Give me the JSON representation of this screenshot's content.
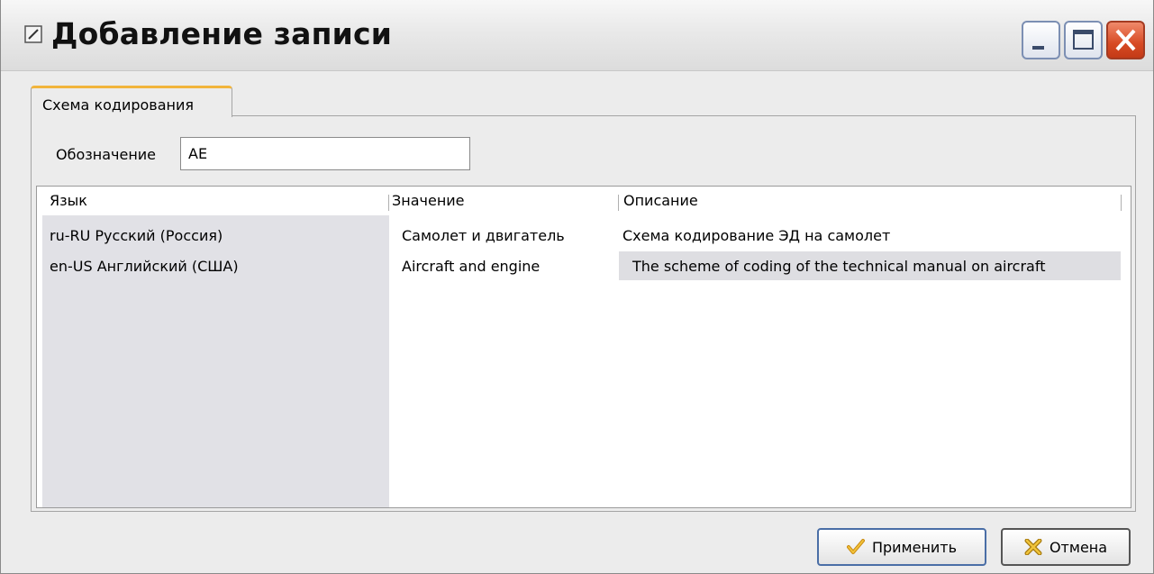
{
  "window": {
    "title": "Добавление записи",
    "icon": "notepad-icon",
    "buttons": [
      "minimize-icon",
      "maximize-icon",
      "close-icon"
    ]
  },
  "tabs": [
    {
      "label": "Схема кодирования",
      "active": true
    }
  ],
  "form": {
    "designation_label": "Обозначение",
    "designation_value": "AE"
  },
  "grid": {
    "columns": [
      "Язык",
      "Значение",
      "Описание"
    ],
    "rows": [
      {
        "language": "ru-RU  Русский (Россия)",
        "value": "Самолет и двигатель",
        "description": "Схема кодирование ЭД на самолет"
      },
      {
        "language": "en-US  Английский (США)",
        "value": "Aircraft and engine",
        "description": "The scheme of coding of the technical manual on aircraft"
      }
    ]
  },
  "buttons": {
    "apply": "Применить",
    "cancel": "Отмена"
  },
  "colors": {
    "tab_accent": "#f2b53c",
    "close_button": "#d74a24",
    "selection": "#dedee2"
  }
}
